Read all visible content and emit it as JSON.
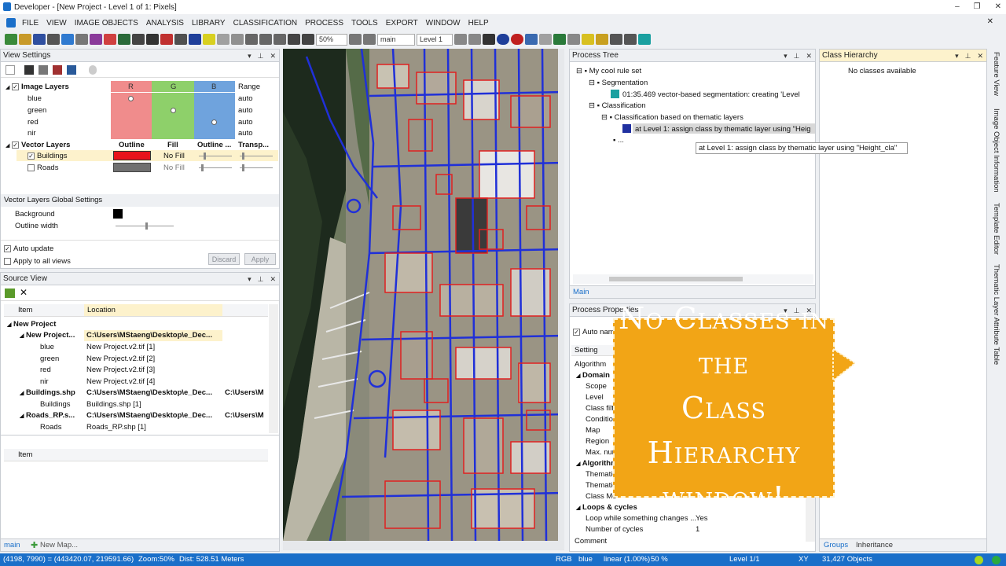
{
  "window": {
    "title": "Developer - [New Project - Level 1 of 1: Pixels]",
    "min": "–",
    "max": "❐",
    "close": "✕"
  },
  "menu": [
    "FILE",
    "VIEW",
    "IMAGE OBJECTS",
    "ANALYSIS",
    "LIBRARY",
    "CLASSIFICATION",
    "PROCESS",
    "TOOLS",
    "EXPORT",
    "WINDOW",
    "HELP"
  ],
  "toolbar": {
    "zoom": "50%",
    "map": "main",
    "level": "Level 1"
  },
  "view_settings": {
    "title": "View Settings",
    "image_layers": "Image Layers",
    "cols": {
      "r": "R",
      "g": "G",
      "b": "B",
      "range": "Range"
    },
    "layers": [
      {
        "name": "blue",
        "range": "auto"
      },
      {
        "name": "green",
        "range": "auto"
      },
      {
        "name": "red",
        "range": "auto"
      },
      {
        "name": "nir",
        "range": "auto"
      }
    ],
    "vector_layers": "Vector Layers",
    "vcols": {
      "outline": "Outline",
      "fill": "Fill",
      "outline2": "Outline ...",
      "transp": "Transp..."
    },
    "vectors": [
      {
        "name": "Buildings",
        "fill": "No Fill",
        "color": "#e8141a"
      },
      {
        "name": "Roads",
        "fill": "No Fill",
        "color": "#707070"
      }
    ],
    "global_title": "Vector Layers Global Settings",
    "background": "Background",
    "outline_width": "Outline width",
    "auto_update": "Auto update",
    "apply_all": "Apply to all views",
    "discard": "Discard",
    "apply": "Apply"
  },
  "source_view": {
    "title": "Source View",
    "col_item": "Item",
    "col_location": "Location",
    "rows": [
      {
        "item": "New Project",
        "loc": "",
        "extra": ""
      },
      {
        "item": "New Project...",
        "loc": "C:\\Users\\MStaeng\\Desktop\\e_Dec...",
        "extra": ""
      },
      {
        "item": "blue",
        "loc": "New Project.v2.tif [1]",
        "extra": ""
      },
      {
        "item": "green",
        "loc": "New Project.v2.tif [2]",
        "extra": ""
      },
      {
        "item": "red",
        "loc": "New Project.v2.tif [3]",
        "extra": ""
      },
      {
        "item": "nir",
        "loc": "New Project.v2.tif [4]",
        "extra": ""
      },
      {
        "item": "Buildings.shp",
        "loc": "C:\\Users\\MStaeng\\Desktop\\e_Dec...",
        "extra": "C:\\Users\\M"
      },
      {
        "item": "Buildings",
        "loc": "Buildings.shp [1]",
        "extra": ""
      },
      {
        "item": "Roads_RP.s...",
        "loc": "C:\\Users\\MStaeng\\Desktop\\e_Dec...",
        "extra": "C:\\Users\\M"
      },
      {
        "item": "Roads",
        "loc": "Roads_RP.shp [1]",
        "extra": ""
      }
    ],
    "col_item2": "Item",
    "tab_main": "main",
    "tab_new": "New Map..."
  },
  "process_tree": {
    "title": "Process Tree",
    "items": [
      "My cool rule set",
      "Segmentation",
      "01:35.469   vector-based segmentation: creating 'Level",
      "Classification",
      "Classification based on thematic layers",
      "at  Level 1: assign class by thematic layer using \"Heig",
      "..."
    ],
    "tooltip": "at  Level 1: assign class by thematic layer using \"Height_cla\"",
    "tab": "Main"
  },
  "class_hierarchy": {
    "title": "Class Hierarchy",
    "empty": "No classes available",
    "tab_groups": "Groups",
    "tab_inheritance": "Inheritance"
  },
  "process_props": {
    "title": "Process Properties",
    "auto_name": "Auto nam",
    "setting": "Setting",
    "algorithm": "Algorithm",
    "rows": [
      "Domain",
      "Scope",
      "Level",
      "Class filter",
      "Condition",
      "Map",
      "Region",
      "Max. num",
      "Algorithm",
      "Thematic",
      "Thematic",
      "Class Mo"
    ],
    "loops": "Loops & cycles",
    "loop_while": "Loop while something changes ...",
    "loop_while_val": "Yes",
    "num_cycles": "Number of cycles",
    "num_cycles_val": "1",
    "comment": "Comment"
  },
  "side_tabs": [
    "Feature View",
    "Image Object Information",
    "Template Editor",
    "Thematic Layer Attribute Table"
  ],
  "callout": {
    "line1": "No Classes in the",
    "line2": "Class Hierarchy",
    "line3": "window!"
  },
  "status": {
    "coords": "(4198, 7990) = (443420.07, 219591.66)",
    "zoom": "Zoom:50%",
    "dist": "Dist: 528.51 Meters",
    "rgb": "RGB",
    "band": "blue",
    "stretch": "linear (1.00%)",
    "pct": "50 %",
    "level": "Level 1/1",
    "xy": "XY",
    "objects": "31,427 Objects"
  },
  "colors": {
    "accent": "#1a6fc9",
    "callout": "#f2a516",
    "r": "#f08c8c",
    "g": "#8ed06a",
    "b": "#6fa3dd"
  }
}
